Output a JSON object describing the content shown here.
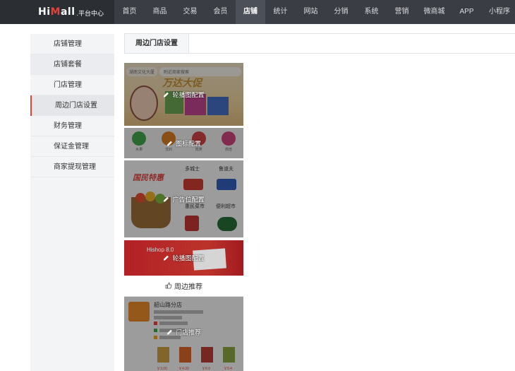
{
  "brand": {
    "name_prefix": "Hi",
    "name_mid": "M",
    "name_suffix": "all",
    "subtitle": ".平台中心"
  },
  "nav": {
    "items": [
      {
        "label": "首页",
        "width": 43
      },
      {
        "label": "商品",
        "width": 43
      },
      {
        "label": "交易",
        "width": 43
      },
      {
        "label": "会员",
        "width": 43
      },
      {
        "label": "店铺",
        "width": 42,
        "active": true
      },
      {
        "label": "统计",
        "width": 43
      },
      {
        "label": "网站",
        "width": 43
      },
      {
        "label": "分销",
        "width": 43
      },
      {
        "label": "系统",
        "width": 43
      },
      {
        "label": "营销",
        "width": 43
      },
      {
        "label": "微商城",
        "width": 49
      },
      {
        "label": "APP",
        "width": 43
      },
      {
        "label": "小程序",
        "width": 50
      }
    ]
  },
  "sidebar": {
    "items": [
      {
        "label": "店铺管理"
      },
      {
        "label": "店铺套餐"
      },
      {
        "label": "门店管理"
      },
      {
        "label": "周边门店设置"
      },
      {
        "label": "财务管理"
      },
      {
        "label": "保证金管理"
      },
      {
        "label": "商家提现管理"
      }
    ]
  },
  "tab": {
    "label": "周边门店设置"
  },
  "preview": {
    "search": {
      "location": "湖南文化大厦",
      "placeholder": "附近商家搜索"
    },
    "banner_title": "万达大促",
    "blocks": {
      "carousel1_label": "轮播图配置",
      "icons_label": "图标配置",
      "ads_label": "广告位配置",
      "carousel2_label": "轮播图配置",
      "nearby_label": "门店推荐"
    },
    "icons": [
      {
        "label": "水果",
        "color": "#3aa844"
      },
      {
        "label": "饮料",
        "color": "#e07b1a"
      },
      {
        "label": "肉类",
        "color": "#d63c3c"
      },
      {
        "label": "烘焙",
        "color": "#d43c7c"
      }
    ],
    "ads": {
      "title": "国民特惠",
      "shops": [
        "多城士",
        "鲁道夫",
        "惠民菜市",
        "便利超市"
      ]
    },
    "carousel2_text": "Hishop 8.0",
    "nearby": {
      "header": "周边推荐",
      "store_name": "韶山路分店",
      "prices": [
        "￥3.00",
        "￥4.00",
        "￥8.0",
        "￥5.4"
      ]
    }
  }
}
